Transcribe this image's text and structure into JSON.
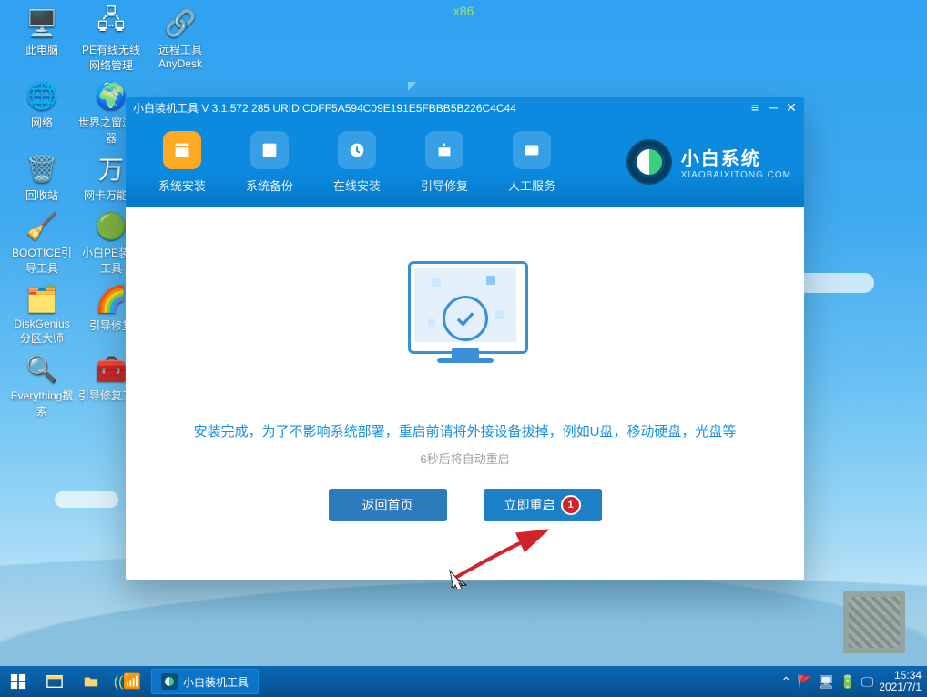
{
  "arch_label": "x86",
  "desktop_icons": [
    {
      "label": "此电脑",
      "glyph": "🖥️"
    },
    {
      "label": "PE有线无线网络管理",
      "glyph": "🖧"
    },
    {
      "label": "远程工具AnyDesk",
      "glyph": "🔗"
    },
    {
      "label": "网络",
      "glyph": "🌐"
    },
    {
      "label": "世界之窗浏览器",
      "glyph": "🌍"
    },
    {
      "label": "",
      "glyph": ""
    },
    {
      "label": "回收站",
      "glyph": "🗑️"
    },
    {
      "label": "网卡万能驱",
      "glyph": "万"
    },
    {
      "label": "",
      "glyph": ""
    },
    {
      "label": "BOOTICE引导工具",
      "glyph": "🧹"
    },
    {
      "label": "小白PE装机工具",
      "glyph": "🟢"
    },
    {
      "label": "",
      "glyph": ""
    },
    {
      "label": "DiskGenius分区大师",
      "glyph": "🗂️"
    },
    {
      "label": "引导修复",
      "glyph": "🌈"
    },
    {
      "label": "",
      "glyph": ""
    },
    {
      "label": "Everything搜索",
      "glyph": "🔍"
    },
    {
      "label": "引导修复工具",
      "glyph": "🧰"
    },
    {
      "label": "",
      "glyph": ""
    }
  ],
  "window": {
    "title": "小白装机工具 V 3.1.572.285 URID:CDFF5A594C09E191E5FBBB5B226C4C44",
    "brand_title": "小白系统",
    "brand_sub": "XIAOBAIXITONG.COM",
    "tools": [
      {
        "label": "系统安装",
        "active": true
      },
      {
        "label": "系统备份",
        "active": false
      },
      {
        "label": "在线安装",
        "active": false
      },
      {
        "label": "引导修复",
        "active": false
      },
      {
        "label": "人工服务",
        "active": false
      }
    ],
    "message_main": "安装完成，为了不影响系统部署，重启前请将外接设备拔掉，例如U盘，移动硬盘，光盘等",
    "message_sub": "6秒后将自动重启",
    "btn_return": "返回首页",
    "btn_restart": "立即重启",
    "marker_num": "1"
  },
  "taskbar": {
    "task_label": "小白装机工具",
    "time": "15:34",
    "date": "2021/7/1"
  }
}
